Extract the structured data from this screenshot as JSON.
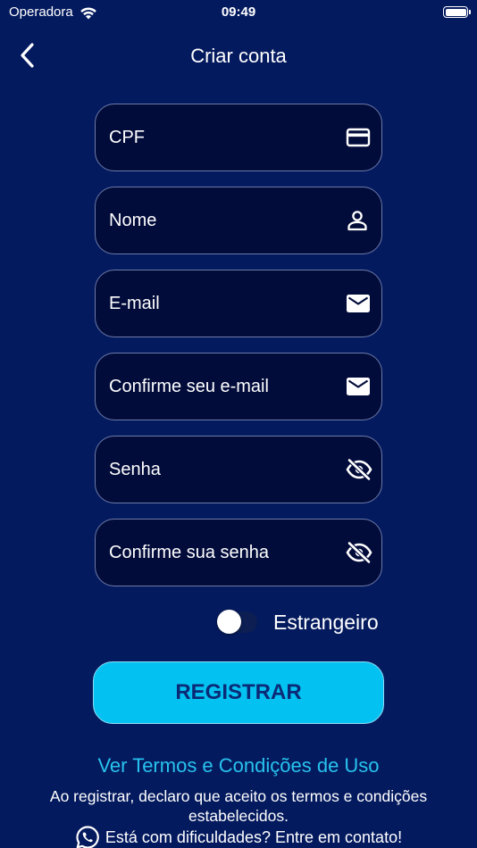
{
  "status_bar": {
    "carrier": "Operadora",
    "time": "09:49",
    "battery_level": 1.0
  },
  "nav": {
    "title": "Criar conta",
    "back_icon": "chevron-left-icon"
  },
  "form": {
    "fields": [
      {
        "placeholder": "CPF",
        "icon": "credit-card-icon",
        "value": ""
      },
      {
        "placeholder": "Nome",
        "icon": "person-icon",
        "value": ""
      },
      {
        "placeholder": "E-mail",
        "icon": "envelope-icon",
        "value": ""
      },
      {
        "placeholder": "Confirme seu e-mail",
        "icon": "envelope-icon",
        "value": ""
      },
      {
        "placeholder": "Senha",
        "icon": "eye-off-icon",
        "value": ""
      },
      {
        "placeholder": "Confirme sua senha",
        "icon": "eye-off-icon",
        "value": ""
      }
    ],
    "foreigner_toggle": {
      "label": "Estrangeiro",
      "on": false
    }
  },
  "register_button": {
    "label": "REGISTRAR"
  },
  "terms_link": "Ver Termos e Condições de Uso",
  "disclaimer": "Ao registrar, declaro que aceito os termos e condições estabelecidos.",
  "contact": {
    "text": "Está com dificuldades? Entre em contato!",
    "icon": "whatsapp-icon"
  },
  "colors": {
    "background": "#041a5e",
    "field_background": "#020c3a",
    "accent": "#03c2f2",
    "link": "#27c3ee",
    "button_text": "#0b2a76"
  }
}
